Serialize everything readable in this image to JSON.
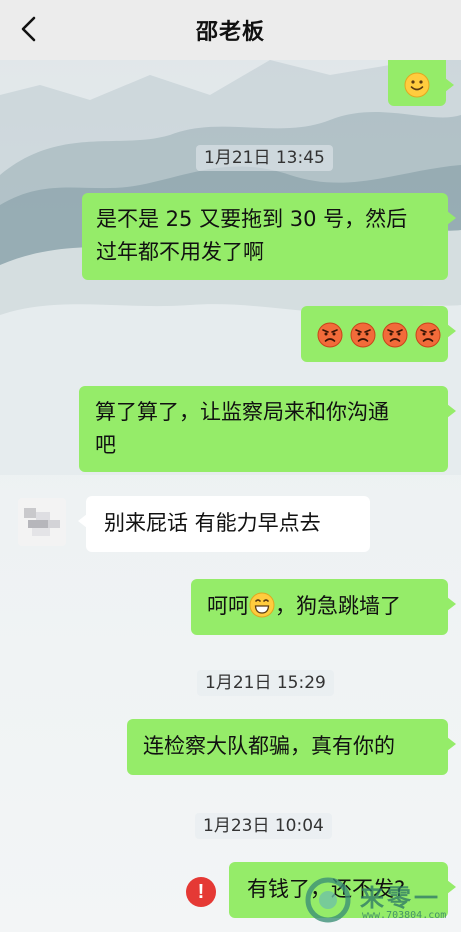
{
  "header": {
    "title": "邵老板",
    "back_icon": "chevron-left-icon"
  },
  "messages": [
    {
      "sender": "me",
      "type": "emoji",
      "emoji": "smile-emoji"
    },
    {
      "type": "timestamp",
      "text": "1月21日 13:45"
    },
    {
      "sender": "me",
      "line1": "是不是 25 又要拖到 30 号，然后",
      "line2": "过年都不用发了啊"
    },
    {
      "sender": "me",
      "type": "emoji",
      "emoji": "angry-face-emoji",
      "count": 4
    },
    {
      "sender": "me",
      "line1": "算了算了，让监察局来和你沟通",
      "line2": "吧"
    },
    {
      "sender": "other",
      "text": "别来屁话 有能力早点去"
    },
    {
      "sender": "me",
      "text_before": "呵呵",
      "emoji": "grin-emoji",
      "text_after": "，狗急跳墙了"
    },
    {
      "type": "timestamp",
      "text": "1月21日 15:29"
    },
    {
      "sender": "me",
      "text": "连检察大队都骗，真有你的"
    },
    {
      "type": "timestamp",
      "text": "1月23日 10:04"
    },
    {
      "sender": "me",
      "text": "有钱了，还不发?",
      "status": "send-failed"
    }
  ],
  "watermark": {
    "brand": "来零一",
    "url": "www.703804.com"
  },
  "colors": {
    "my_bubble": "#95ec69",
    "other_bubble": "#ffffff",
    "error": "#e53935"
  }
}
